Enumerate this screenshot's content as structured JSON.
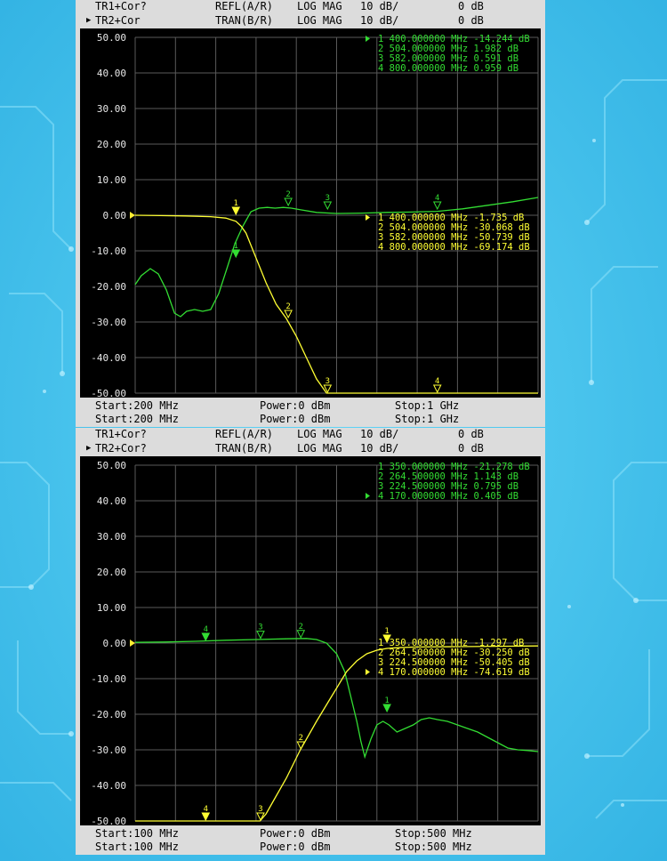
{
  "charts": [
    {
      "header": [
        {
          "trace": "TR1+Cor?",
          "meas": "REFL(A/R)",
          "format": "LOG MAG",
          "scale": "10 dB/",
          "ref": "0 dB",
          "active": false
        },
        {
          "trace": "TR2+Cor",
          "meas": "TRAN(B/R)",
          "format": "LOG MAG",
          "scale": "10 dB/",
          "ref": "0 dB",
          "active": true
        }
      ],
      "footer": [
        {
          "start": "Start:200 MHz",
          "power": "Power:0 dBm",
          "stop": "Stop:1 GHz"
        },
        {
          "start": "Start:200 MHz",
          "power": "Power:0 dBm",
          "stop": "Stop:1 GHz"
        }
      ]
    },
    {
      "header": [
        {
          "trace": "TR1+Cor?",
          "meas": "REFL(A/R)",
          "format": "LOG MAG",
          "scale": "10 dB/",
          "ref": "0 dB",
          "active": false
        },
        {
          "trace": "TR2+Cor?",
          "meas": "TRAN(B/R)",
          "format": "LOG MAG",
          "scale": "10 dB/",
          "ref": "0 dB",
          "active": true
        }
      ],
      "footer": [
        {
          "start": "Start:100 MHz",
          "power": "Power:0 dBm",
          "stop": "Stop:500 MHz"
        },
        {
          "start": "Start:100 MHz",
          "power": "Power:0 dBm",
          "stop": "Stop:500 MHz"
        }
      ]
    }
  ],
  "chart_data": [
    {
      "type": "line",
      "x_unit": "MHz",
      "xlim": [
        200,
        1000
      ],
      "ylim": [
        -50,
        50
      ],
      "y_ticks": [
        "50.00",
        "40.00",
        "30.00",
        "20.00",
        "10.00",
        "0.00",
        "-10.00",
        "-20.00",
        "-30.00",
        "-40.00",
        "-50.00"
      ],
      "grid": true,
      "series": [
        {
          "color": "#33dd33",
          "x": [
            200,
            212,
            230,
            246,
            262,
            278,
            290,
            302,
            318,
            334,
            350,
            366,
            382,
            398,
            414,
            430,
            446,
            462,
            478,
            494,
            510,
            530,
            560,
            600,
            650,
            700,
            750,
            800,
            850,
            900,
            950,
            1000
          ],
          "y": [
            -19.5,
            -17,
            -15,
            -16.5,
            -21,
            -27.5,
            -28.5,
            -27,
            -26.5,
            -27,
            -26.5,
            -22,
            -15,
            -8,
            -3,
            1,
            2,
            2.2,
            2,
            2.2,
            2,
            1.5,
            0.8,
            0.5,
            0.6,
            0.8,
            0.9,
            1.1,
            1.8,
            2.8,
            3.8,
            5
          ]
        },
        {
          "color": "#ffff33",
          "x": [
            200,
            250,
            300,
            350,
            380,
            400,
            410,
            420,
            440,
            460,
            480,
            500,
            520,
            540,
            560,
            580,
            600,
            700,
            800,
            900,
            1000
          ],
          "y": [
            0,
            -0.1,
            -0.2,
            -0.4,
            -0.8,
            -1.7,
            -3,
            -5,
            -12,
            -19,
            -25,
            -29,
            -34,
            -40,
            -46,
            -50,
            -50,
            -50,
            -50,
            -50,
            -50
          ]
        }
      ],
      "markers": [
        {
          "color": "#33dd33",
          "points": [
            {
              "n": "1",
              "x": 400,
              "y": -12
            },
            {
              "n": "2",
              "x": 504,
              "y": 2.5
            },
            {
              "n": "3",
              "x": 582,
              "y": 1.5
            },
            {
              "n": "4",
              "x": 800,
              "y": 1.5
            }
          ],
          "readout": [
            {
              "label": "1 400.000000 MHz -14.244 dB",
              "active": true
            },
            {
              "label": "2 504.000000 MHz 1.982 dB",
              "active": false
            },
            {
              "label": "3 582.000000 MHz 0.591 dB",
              "active": false
            },
            {
              "label": "4 800.000000 MHz 0.959 dB",
              "active": false
            }
          ]
        },
        {
          "color": "#ffff33",
          "points": [
            {
              "n": "1",
              "x": 400,
              "y": 0
            },
            {
              "n": "2",
              "x": 504,
              "y": -29
            },
            {
              "n": "3",
              "x": 582,
              "y": -50
            },
            {
              "n": "4",
              "x": 800,
              "y": -50
            }
          ],
          "readout": [
            {
              "label": "1 400.000000 MHz -1.735 dB",
              "active": true
            },
            {
              "label": "2 504.000000 MHz -30.068 dB",
              "active": false
            },
            {
              "label": "3 582.000000 MHz -50.739 dB",
              "active": false
            },
            {
              "label": "4 800.000000 MHz -69.174 dB",
              "active": false
            }
          ]
        }
      ]
    },
    {
      "type": "line",
      "x_unit": "MHz",
      "xlim": [
        100,
        500
      ],
      "ylim": [
        -50,
        50
      ],
      "y_ticks": [
        "50.00",
        "40.00",
        "30.00",
        "20.00",
        "10.00",
        "0.00",
        "-10.00",
        "-20.00",
        "-30.00",
        "-40.00",
        "-50.00"
      ],
      "grid": true,
      "series": [
        {
          "color": "#33dd33",
          "x": [
            100,
            130,
            160,
            190,
            220,
            250,
            270,
            280,
            290,
            300,
            308,
            314,
            320,
            324,
            328,
            334,
            340,
            346,
            352,
            360,
            368,
            376,
            384,
            392,
            400,
            410,
            420,
            430,
            440,
            450,
            460,
            470,
            480,
            490,
            500
          ],
          "y": [
            0.2,
            0.3,
            0.5,
            0.8,
            1,
            1.2,
            1.3,
            1,
            0,
            -3,
            -8,
            -15,
            -22,
            -27.5,
            -32,
            -27,
            -23,
            -22,
            -23,
            -25,
            -24,
            -23,
            -21.5,
            -21,
            -21.5,
            -22,
            -23,
            -24,
            -25,
            -26.5,
            -28,
            -29.5,
            -30,
            -30.2,
            -30.5
          ]
        },
        {
          "color": "#ffff33",
          "x": [
            100,
            150,
            200,
            220,
            224,
            230,
            240,
            250,
            264,
            280,
            295,
            310,
            320,
            330,
            340,
            350,
            360,
            380,
            420,
            460,
            500
          ],
          "y": [
            -50,
            -50,
            -50,
            -50,
            -50,
            -48,
            -43,
            -38,
            -30,
            -22,
            -15,
            -8,
            -5,
            -3,
            -2,
            -1.5,
            -1.3,
            -1.1,
            -1,
            -0.9,
            -0.8
          ]
        }
      ],
      "markers": [
        {
          "color": "#33dd33",
          "points": [
            {
              "n": "1",
              "x": 350,
              "y": -19.5
            },
            {
              "n": "2",
              "x": 264.5,
              "y": 1.3
            },
            {
              "n": "3",
              "x": 224.5,
              "y": 1.1
            },
            {
              "n": "4",
              "x": 170,
              "y": 0.5
            }
          ],
          "readout": [
            {
              "label": "1 350.000000 MHz -21.278 dB",
              "active": false
            },
            {
              "label": "2 264.500000 MHz 1.143 dB",
              "active": false
            },
            {
              "label": "3 224.500000 MHz 0.795 dB",
              "active": false
            },
            {
              "label": "4 170.000000 MHz 0.405 dB",
              "active": true
            }
          ]
        },
        {
          "color": "#ffff33",
          "points": [
            {
              "n": "1",
              "x": 350,
              "y": 0
            },
            {
              "n": "2",
              "x": 264.5,
              "y": -30
            },
            {
              "n": "3",
              "x": 224.5,
              "y": -50
            },
            {
              "n": "4",
              "x": 170,
              "y": -50
            }
          ],
          "readout": [
            {
              "label": "1 350.000000 MHz -1.297 dB",
              "active": false
            },
            {
              "label": "2 264.500000 MHz -30.250 dB",
              "active": false
            },
            {
              "label": "3 224.500000 MHz -50.405 dB",
              "active": false
            },
            {
              "label": "4 170.000000 MHz -74.619 dB",
              "active": true
            }
          ]
        }
      ]
    }
  ]
}
